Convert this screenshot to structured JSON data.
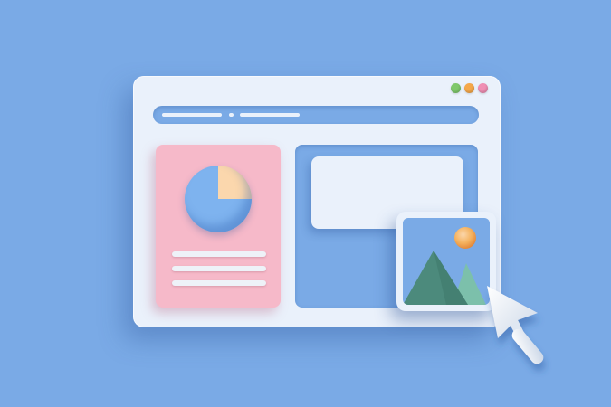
{
  "colors": {
    "background": "#7aaae6",
    "window": "#eaf1fb",
    "card_left": "#f6b9c9",
    "card_right": "#7aaae6",
    "pie_slice": "#fbd7ad",
    "pie_main": "#7eb3ef",
    "mountain_dark": "#4c8a7c",
    "mountain_light": "#7cc0ab",
    "sun": "#f5a84a",
    "cursor": "#eef2f8"
  },
  "window_controls": [
    {
      "name": "green-dot",
      "color": "#7fc86b"
    },
    {
      "name": "orange-dot",
      "color": "#f5a84a"
    },
    {
      "name": "pink-dot",
      "color": "#f08fb4"
    }
  ],
  "icons": [
    "pie-chart-icon",
    "image-icon",
    "mountain-icon",
    "sun-icon",
    "cursor-icon"
  ]
}
